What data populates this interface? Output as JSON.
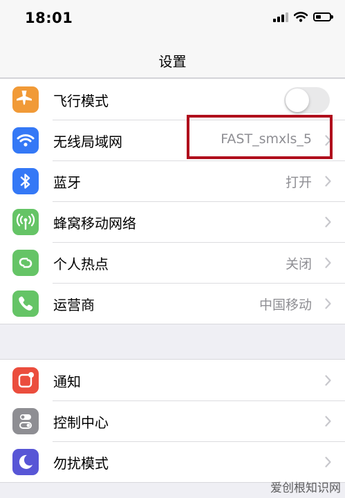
{
  "status_bar": {
    "time": "18:01"
  },
  "nav": {
    "title": "设置"
  },
  "group1": [
    {
      "label": "飞行模式",
      "value": "",
      "type": "toggle",
      "icon": "airplane-icon",
      "color": "#f19a37"
    },
    {
      "label": "无线局域网",
      "value": "FAST_smxls_5",
      "type": "link",
      "icon": "wifi-icon",
      "color": "#3478f6"
    },
    {
      "label": "蓝牙",
      "value": "打开",
      "type": "link",
      "icon": "bluetooth-icon",
      "color": "#3478f6"
    },
    {
      "label": "蜂窝移动网络",
      "value": "",
      "type": "link",
      "icon": "antenna-icon",
      "color": "#65c466"
    },
    {
      "label": "个人热点",
      "value": "关闭",
      "type": "link",
      "icon": "hotspot-icon",
      "color": "#65c466"
    },
    {
      "label": "运营商",
      "value": "中国移动",
      "type": "link",
      "icon": "phone-icon",
      "color": "#65c466"
    }
  ],
  "group2": [
    {
      "label": "通知",
      "value": "",
      "type": "link",
      "icon": "notifications-icon",
      "color": "#eb4d3d"
    },
    {
      "label": "控制中心",
      "value": "",
      "type": "link",
      "icon": "switches-icon",
      "color": "#8e8e93"
    },
    {
      "label": "勿扰模式",
      "value": "",
      "type": "link",
      "icon": "moon-icon",
      "color": "#5856d6"
    }
  ],
  "airplane_mode_on": false,
  "highlight_color": "#b00d1c",
  "watermark": "爱创根知识网"
}
